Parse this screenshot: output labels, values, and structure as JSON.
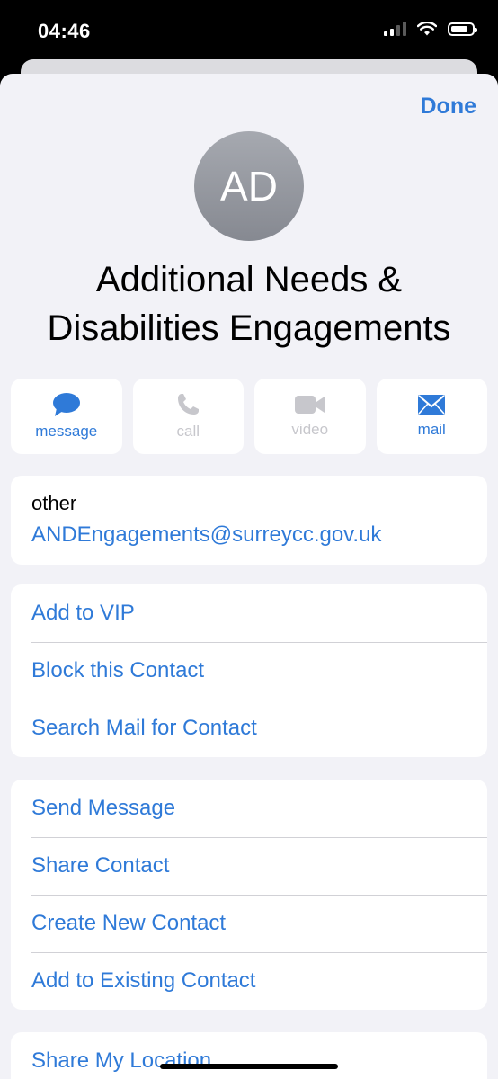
{
  "status_bar": {
    "time": "04:46"
  },
  "header": {
    "done_label": "Done"
  },
  "contact": {
    "initials": "AD",
    "name_line1": "Additional Needs &",
    "name_line2": "Disabilities Engagements"
  },
  "actions": [
    {
      "label": "message",
      "icon": "message-bubble-icon",
      "enabled": true
    },
    {
      "label": "call",
      "icon": "phone-icon",
      "enabled": false
    },
    {
      "label": "video",
      "icon": "video-camera-icon",
      "enabled": false
    },
    {
      "label": "mail",
      "icon": "envelope-icon",
      "enabled": true
    }
  ],
  "email": {
    "label": "other",
    "value": "ANDEngagements@surreycc.gov.uk"
  },
  "options_group1": [
    "Add to VIP",
    "Block this Contact",
    "Search Mail for Contact"
  ],
  "options_group2": [
    "Send Message",
    "Share Contact",
    "Create New Contact",
    "Add to Existing Contact"
  ],
  "options_group3": [
    "Share My Location"
  ],
  "colors": {
    "accent": "#2f7ad8",
    "disabled": "#c7c7cc",
    "background": "#f2f2f7",
    "avatar": "#8e9198"
  }
}
